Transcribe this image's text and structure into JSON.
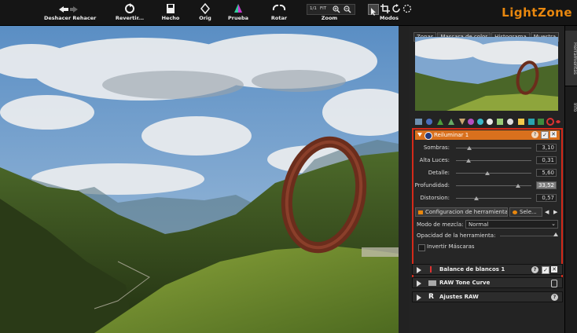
{
  "app": {
    "logo": "LightZone"
  },
  "toolbar": {
    "undo_redo_label": "Deshacer Rehacer",
    "revert_label": "Revertir...",
    "done_label": "Hecho",
    "orig_label": "Orig",
    "proof_label": "Prueba",
    "rotate_label": "Rotar",
    "zoom_label": "Zoom",
    "zoom_ratio": "1/1",
    "zoom_fit": "FIT",
    "modes_label": "Modos"
  },
  "panel": {
    "tabs": [
      "Zonas",
      "Mascara de color",
      "Histograma",
      "Muestra"
    ],
    "active_tab": "Mascara de color"
  },
  "side_tabs": [
    "Herramientas",
    "Info"
  ],
  "tool": {
    "title": "Reiluminar 1",
    "sliders": [
      {
        "label": "Sombras:",
        "value": "3,10",
        "level": 0.18
      },
      {
        "label": "Alta Luces:",
        "value": "0,31",
        "level": 0.17
      },
      {
        "label": "Detalle:",
        "value": "5,60",
        "level": 0.42
      },
      {
        "label": "Profundidad:",
        "value": "33,52",
        "level": 0.82
      },
      {
        "label": "Distorsion:",
        "value": "0,57",
        "level": 0.27
      }
    ],
    "subtabs": [
      "Configuracion de herramientas",
      "Sele..."
    ],
    "blend_label": "Modo de mezcla:",
    "blend_value": "Normal",
    "opacity_label": "Opacidad de la herramienta:",
    "opacity_level": 1.0,
    "invert_label": "Invertir Máscaras"
  },
  "collapsed_tools": [
    {
      "title": "Balance de blancos 1"
    },
    {
      "title": "RAW Tone Curve"
    },
    {
      "title": "Ajustes RAW"
    }
  ],
  "colors": {
    "accent": "#d9701d",
    "highlight_border": "#d42a1a",
    "logo": "#e8870e"
  }
}
